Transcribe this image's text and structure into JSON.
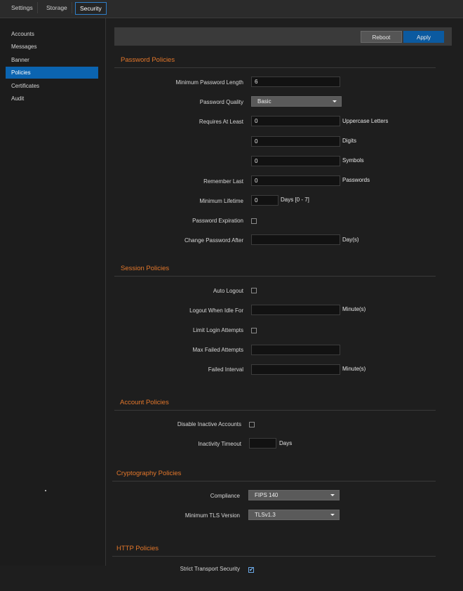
{
  "tabs": [
    "Settings",
    "Storage",
    "Security"
  ],
  "sidebar": {
    "items": [
      "Accounts",
      "Messages",
      "Banner",
      "Policies",
      "Certificates",
      "Audit"
    ]
  },
  "toolbar": {
    "reboot_label": "Reboot",
    "apply_label": "Apply"
  },
  "password_policies": {
    "title": "Password Policies",
    "min_length_label": "Minimum Password Length",
    "min_length_value": "6",
    "quality_label": "Password Quality",
    "quality_value": "Basic",
    "requires_label": "Requires At Least",
    "uppercase_value": "0",
    "uppercase_suffix": "Uppercase Letters",
    "digits_value": "0",
    "digits_suffix": "Digits",
    "symbols_value": "0",
    "symbols_suffix": "Symbols",
    "remember_label": "Remember Last",
    "remember_value": "0",
    "remember_suffix": "Passwords",
    "min_lifetime_label": "Minimum Lifetime",
    "min_lifetime_value": "0",
    "min_lifetime_suffix": "Days [0 - 7]",
    "expiration_label": "Password Expiration",
    "expiration_checked": false,
    "change_after_label": "Change Password After",
    "change_after_value": "",
    "change_after_suffix": "Day(s)"
  },
  "session_policies": {
    "title": "Session Policies",
    "auto_logout_label": "Auto Logout",
    "auto_logout_checked": false,
    "idle_label": "Logout When Idle For",
    "idle_value": "",
    "idle_suffix": "Minute(s)",
    "limit_label": "Limit Login Attempts",
    "limit_checked": false,
    "max_failed_label": "Max Failed Attempts",
    "max_failed_value": "",
    "failed_interval_label": "Failed Interval",
    "failed_interval_value": "",
    "failed_interval_suffix": "Minute(s)"
  },
  "account_policies": {
    "title": "Account Policies",
    "disable_label": "Disable Inactive Accounts",
    "disable_checked": false,
    "timeout_label": "Inactivity Timeout",
    "timeout_value": "",
    "timeout_suffix": "Days"
  },
  "crypto_policies": {
    "title": "Cryptography Policies",
    "compliance_label": "Compliance",
    "compliance_value": "FIPS 140",
    "tls_label": "Minimum TLS Version",
    "tls_value": "TLSv1.3"
  },
  "http_policies": {
    "title": "HTTP Policies",
    "hsts_label": "Strict Transport Security",
    "hsts_checked": true
  },
  "colors": {
    "accent": "#e3772b",
    "selected": "#0b64b0",
    "apply": "#0b5aa0"
  },
  "icons": {
    "dropdown": "caret-down-icon",
    "check": "checkmark-icon"
  }
}
